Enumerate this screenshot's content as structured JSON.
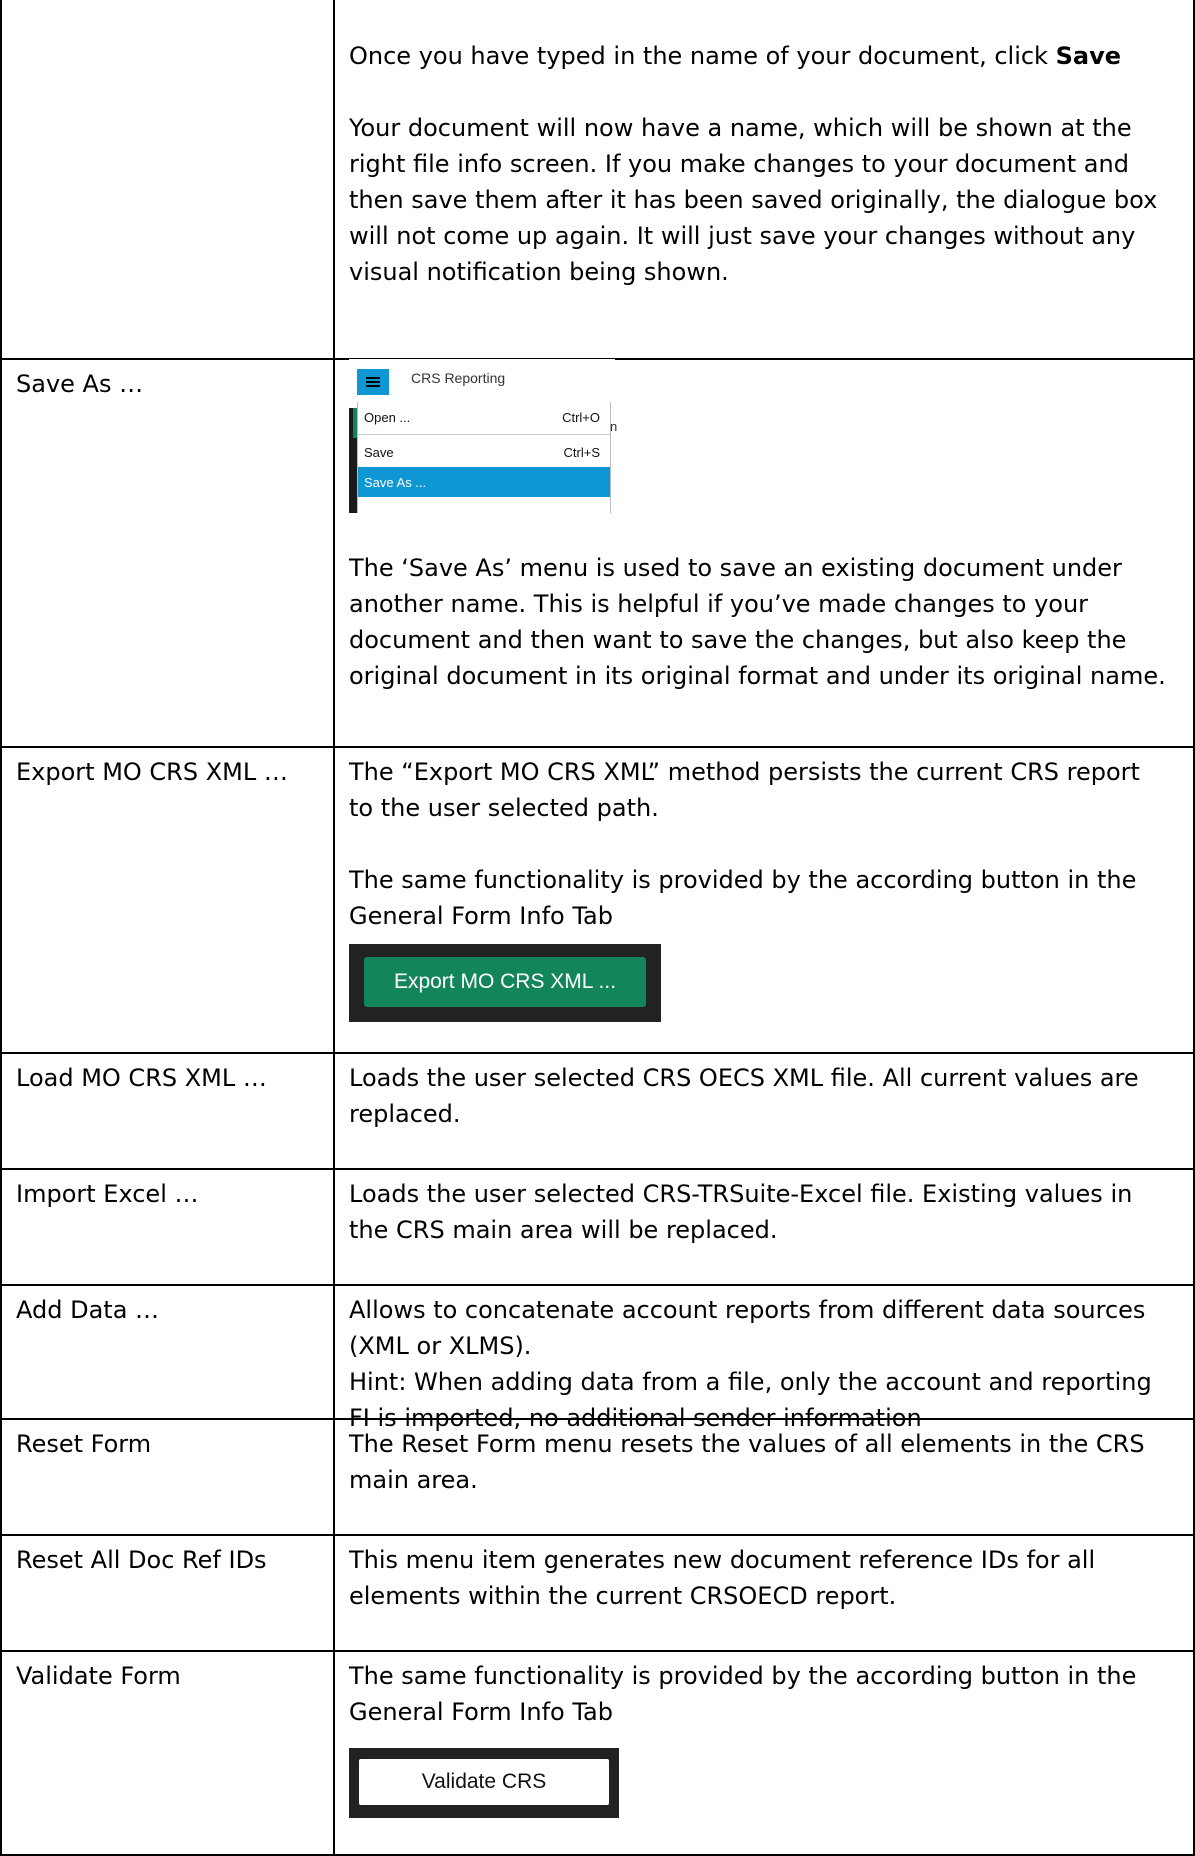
{
  "rows": [
    {
      "label": "",
      "paragraphs": [
        {
          "pre": "Once you have typed in the name of your document, click ",
          "bold": "Save"
        },
        {
          "text": "Your document will now have a name, which will be shown at the right file info screen. If you make changes to your document and then save them after it has been saved originally, the dialogue box will not come up again. It will just save your changes without any visual notification being shown."
        }
      ]
    },
    {
      "label": "Save As …",
      "menu": {
        "app_title": "CRS Reporting",
        "items": [
          {
            "label": "Open ...",
            "shortcut": "Ctrl+O"
          },
          {
            "label": "Save",
            "shortcut": "Ctrl+S"
          },
          {
            "label": "Save As ...",
            "shortcut": ""
          }
        ],
        "cut_text": "n",
        "hamburger_color": "#0f97d4",
        "selected_color": "#0f97d4"
      },
      "text": "The ‘Save As’ menu is used to save an existing document under another name. This is helpful if you’ve made changes to your document and then want to save the changes, but also keep the original document in its original format and under its original name."
    },
    {
      "label": "Export MO CRS XML …",
      "para1": "The “Export MO CRS XML” method persists the current CRS report to the user selected path.",
      "para2": "The same functionality is provided by the according button in the General Form Info Tab",
      "button": "Export MO CRS XML ...",
      "button_color": "#13855a"
    },
    {
      "label": "Load MO CRS XML …",
      "text": "Loads the user selected CRS OECS XML file. All current values are replaced."
    },
    {
      "label": "Import Excel …",
      "text": "Loads the user selected CRS-TRSuite-Excel file. Existing values in the CRS main area will be replaced."
    },
    {
      "label": "Add Data …",
      "text": "Allows to concatenate account reports from different data sources (XML or XLMS).",
      "hint": "Hint: When adding data from a file, only the account and reporting FI is imported, no additional sender information"
    },
    {
      "label": "Reset Form",
      "text": "The Reset Form menu resets the values of all elements in the CRS main area."
    },
    {
      "label": "Reset All Doc Ref IDs",
      "text": "This menu item generates new document reference IDs for all elements within the current CRSOECD report."
    },
    {
      "label": "Validate Form",
      "text": "The same functionality is provided by the according button in the General Form Info Tab",
      "button": "Validate CRS"
    }
  ]
}
